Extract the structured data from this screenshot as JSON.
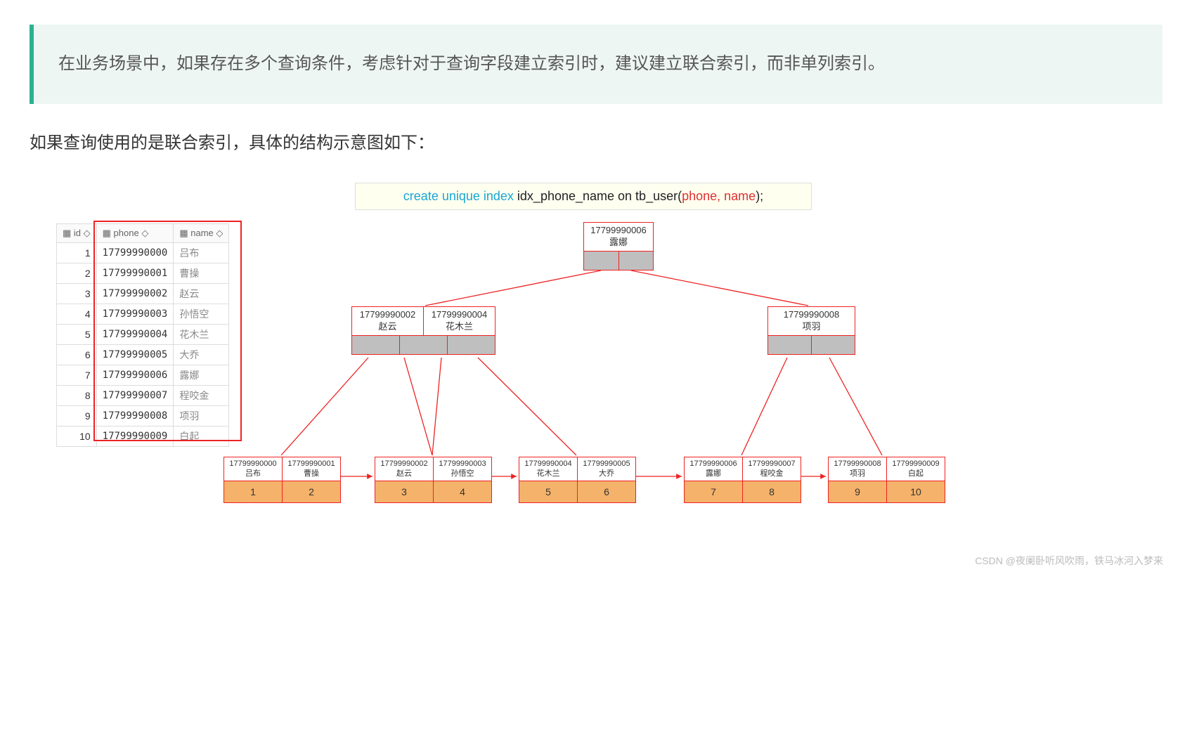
{
  "tip": "在业务场景中，如果存在多个查询条件，考虑针对于查询字段建立索引时，建议建立联合索引，而非单列索引。",
  "subtitle": "如果查询使用的是联合索引，具体的结构示意图如下：",
  "sql": {
    "kw1": "create unique index ",
    "mid": "idx_phone_name on tb_user(",
    "cols": "phone, name",
    "end": ");"
  },
  "table": {
    "cols": [
      "id",
      "phone",
      "name"
    ],
    "rows": [
      {
        "id": "1",
        "phone": "17799990000",
        "name": "吕布"
      },
      {
        "id": "2",
        "phone": "17799990001",
        "name": "曹操"
      },
      {
        "id": "3",
        "phone": "17799990002",
        "name": "赵云"
      },
      {
        "id": "4",
        "phone": "17799990003",
        "name": "孙悟空"
      },
      {
        "id": "5",
        "phone": "17799990004",
        "name": "花木兰"
      },
      {
        "id": "6",
        "phone": "17799990005",
        "name": "大乔"
      },
      {
        "id": "7",
        "phone": "17799990006",
        "name": "露娜"
      },
      {
        "id": "8",
        "phone": "17799990007",
        "name": "程咬金"
      },
      {
        "id": "9",
        "phone": "17799990008",
        "name": "项羽"
      },
      {
        "id": "10",
        "phone": "17799990009",
        "name": "白起"
      }
    ]
  },
  "tree": {
    "root": {
      "cells": [
        {
          "p": "17799990006",
          "n": "露娜"
        }
      ]
    },
    "mid_left": {
      "cells": [
        {
          "p": "17799990002",
          "n": "赵云"
        },
        {
          "p": "17799990004",
          "n": "花木兰"
        }
      ]
    },
    "mid_right": {
      "cells": [
        {
          "p": "17799990008",
          "n": "项羽"
        }
      ]
    },
    "leaves": [
      {
        "cells": [
          {
            "p": "17799990000",
            "n": "吕布",
            "v": "1"
          },
          {
            "p": "17799990001",
            "n": "曹操",
            "v": "2"
          }
        ]
      },
      {
        "cells": [
          {
            "p": "17799990002",
            "n": "赵云",
            "v": "3"
          },
          {
            "p": "17799990003",
            "n": "孙悟空",
            "v": "4"
          }
        ]
      },
      {
        "cells": [
          {
            "p": "17799990004",
            "n": "花木兰",
            "v": "5"
          },
          {
            "p": "17799990005",
            "n": "大乔",
            "v": "6"
          }
        ]
      },
      {
        "cells": [
          {
            "p": "17799990006",
            "n": "露娜",
            "v": "7"
          },
          {
            "p": "17799990007",
            "n": "程咬金",
            "v": "8"
          }
        ]
      },
      {
        "cells": [
          {
            "p": "17799990008",
            "n": "项羽",
            "v": "9"
          },
          {
            "p": "17799990009",
            "n": "白起",
            "v": "10"
          }
        ]
      }
    ]
  },
  "watermark": "CSDN @夜阑卧听风吹雨，铁马冰河入梦来"
}
